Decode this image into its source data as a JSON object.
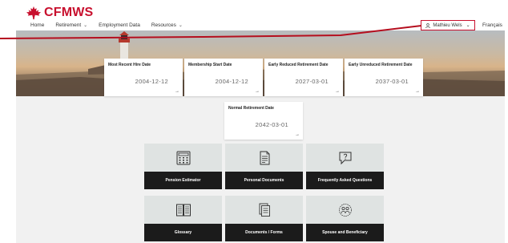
{
  "brand": {
    "name": "CFMWS",
    "color": "#c8102e"
  },
  "nav": {
    "items": [
      {
        "label": "Home",
        "has_dropdown": false
      },
      {
        "label": "Retirement",
        "has_dropdown": true
      },
      {
        "label": "Employment Data",
        "has_dropdown": false
      },
      {
        "label": "Resources",
        "has_dropdown": true
      }
    ],
    "user_label": "Mathieu Wels",
    "language": "Français"
  },
  "date_cards": [
    {
      "title": "Most Recent Hire Date",
      "value": "2004-12-12"
    },
    {
      "title": "Membership Start Date",
      "value": "2004-12-12"
    },
    {
      "title": "Early Reduced Retirement Date",
      "value": "2027-03-01"
    },
    {
      "title": "Early Unreduced Retirement Date",
      "value": "2037-03-01"
    },
    {
      "title": "Normal Retirement Date",
      "value": "2042-03-01"
    }
  ],
  "tiles": [
    {
      "label": "Pension Estimator",
      "icon": "calculator-icon"
    },
    {
      "label": "Personal Documents",
      "icon": "document-icon"
    },
    {
      "label": "Frequently Asked Questions",
      "icon": "question-bubble-icon"
    },
    {
      "label": "Glossary",
      "icon": "book-icon"
    },
    {
      "label": "Documents / Forms",
      "icon": "forms-icon"
    },
    {
      "label": "Spouse and Beneficiary",
      "icon": "people-icon"
    }
  ],
  "icons": {
    "arrow": "→",
    "chevron": "⌄",
    "user": "user-icon"
  }
}
